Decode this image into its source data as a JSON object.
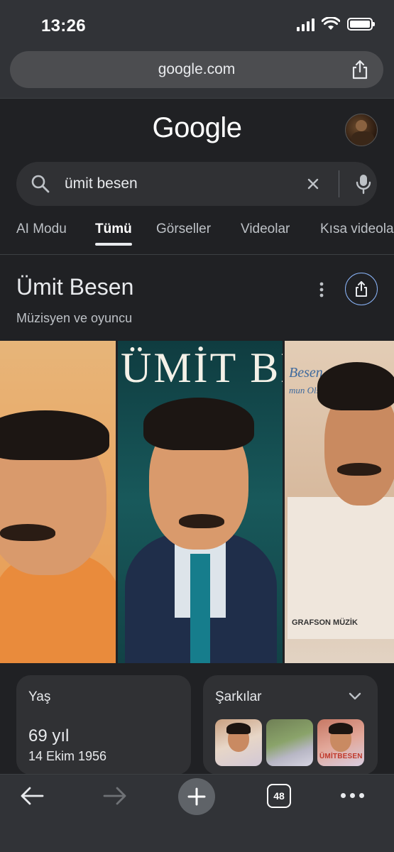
{
  "status_bar": {
    "time": "13:26"
  },
  "browser": {
    "url": "google.com"
  },
  "google": {
    "logo": "Google",
    "search_value": "ümit besen",
    "tabs": [
      {
        "label": "AI Modu",
        "active": false
      },
      {
        "label": "Tümü",
        "active": true
      },
      {
        "label": "Görseller",
        "active": false
      },
      {
        "label": "Videolar",
        "active": false
      },
      {
        "label": "Kısa videolar",
        "active": false
      }
    ]
  },
  "knowledge_panel": {
    "title": "Ümit Besen",
    "subtitle": "Müzisyen ve oyuncu",
    "images": [
      {
        "banner_text": ""
      },
      {
        "banner_text": "ÜMİT BESEN"
      },
      {
        "top_text": "Besen",
        "top_text_2": "mun Olsun",
        "footer": "GRAFSON MÜZİK"
      }
    ],
    "cards": {
      "age": {
        "label": "Yaş",
        "value": "69 yıl",
        "birth_date": "14 Ekim 1956"
      },
      "songs": {
        "label": "Şarkılar",
        "thumb_texts": [
          "",
          "",
          "ÜMİTBESEN"
        ]
      }
    }
  },
  "bottom_bar": {
    "tab_count": "48"
  },
  "colors": {
    "background": "#202124",
    "chrome": "#313337",
    "card": "#303134",
    "accent_blue": "#8ab4f8",
    "text": "#e8eaed"
  }
}
